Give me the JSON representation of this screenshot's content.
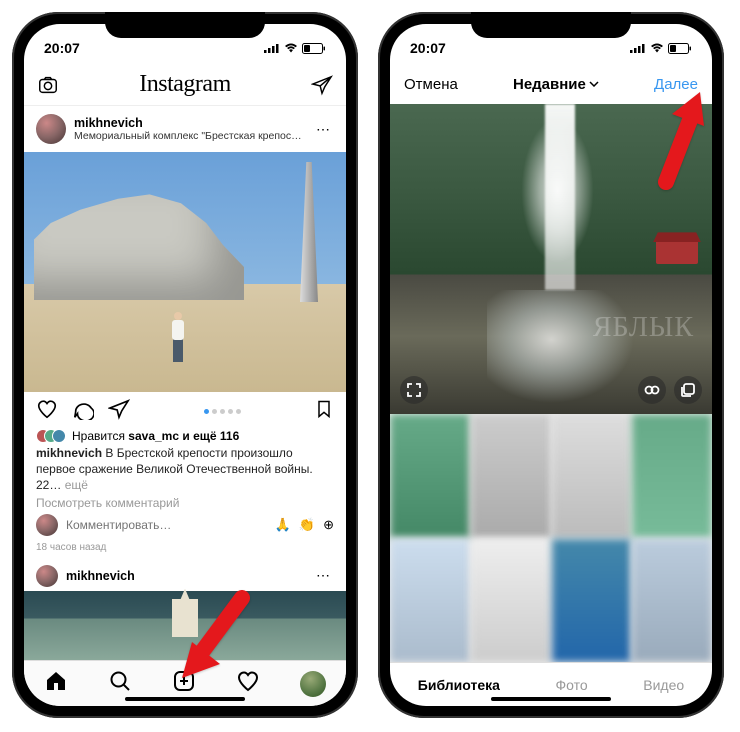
{
  "status": {
    "time": "20:07"
  },
  "feed": {
    "app_name": "Instagram",
    "post1": {
      "username": "mikhnevich",
      "location": "Мемориальный комплекс \"Брестская крепость-ге…",
      "likes_prefix": "Нравится",
      "likes_user": "sava_mc",
      "likes_suffix": "и ещё 116",
      "caption_user": "mikhnevich",
      "caption_text": "В Брестской крепости произошло первое сражение Великой Отечественной войны. 22…",
      "caption_more": "ещё",
      "view_comments": "Посмотреть комментарий",
      "comment_placeholder": "Комментировать…",
      "timestamp": "18 часов назад"
    },
    "post2": {
      "username": "mikhnevich"
    }
  },
  "picker": {
    "cancel": "Отмена",
    "title": "Недавние",
    "next": "Далее",
    "watermark": "ЯБЛЫК",
    "tabs": {
      "library": "Библиотека",
      "photo": "Фото",
      "video": "Видео"
    }
  }
}
